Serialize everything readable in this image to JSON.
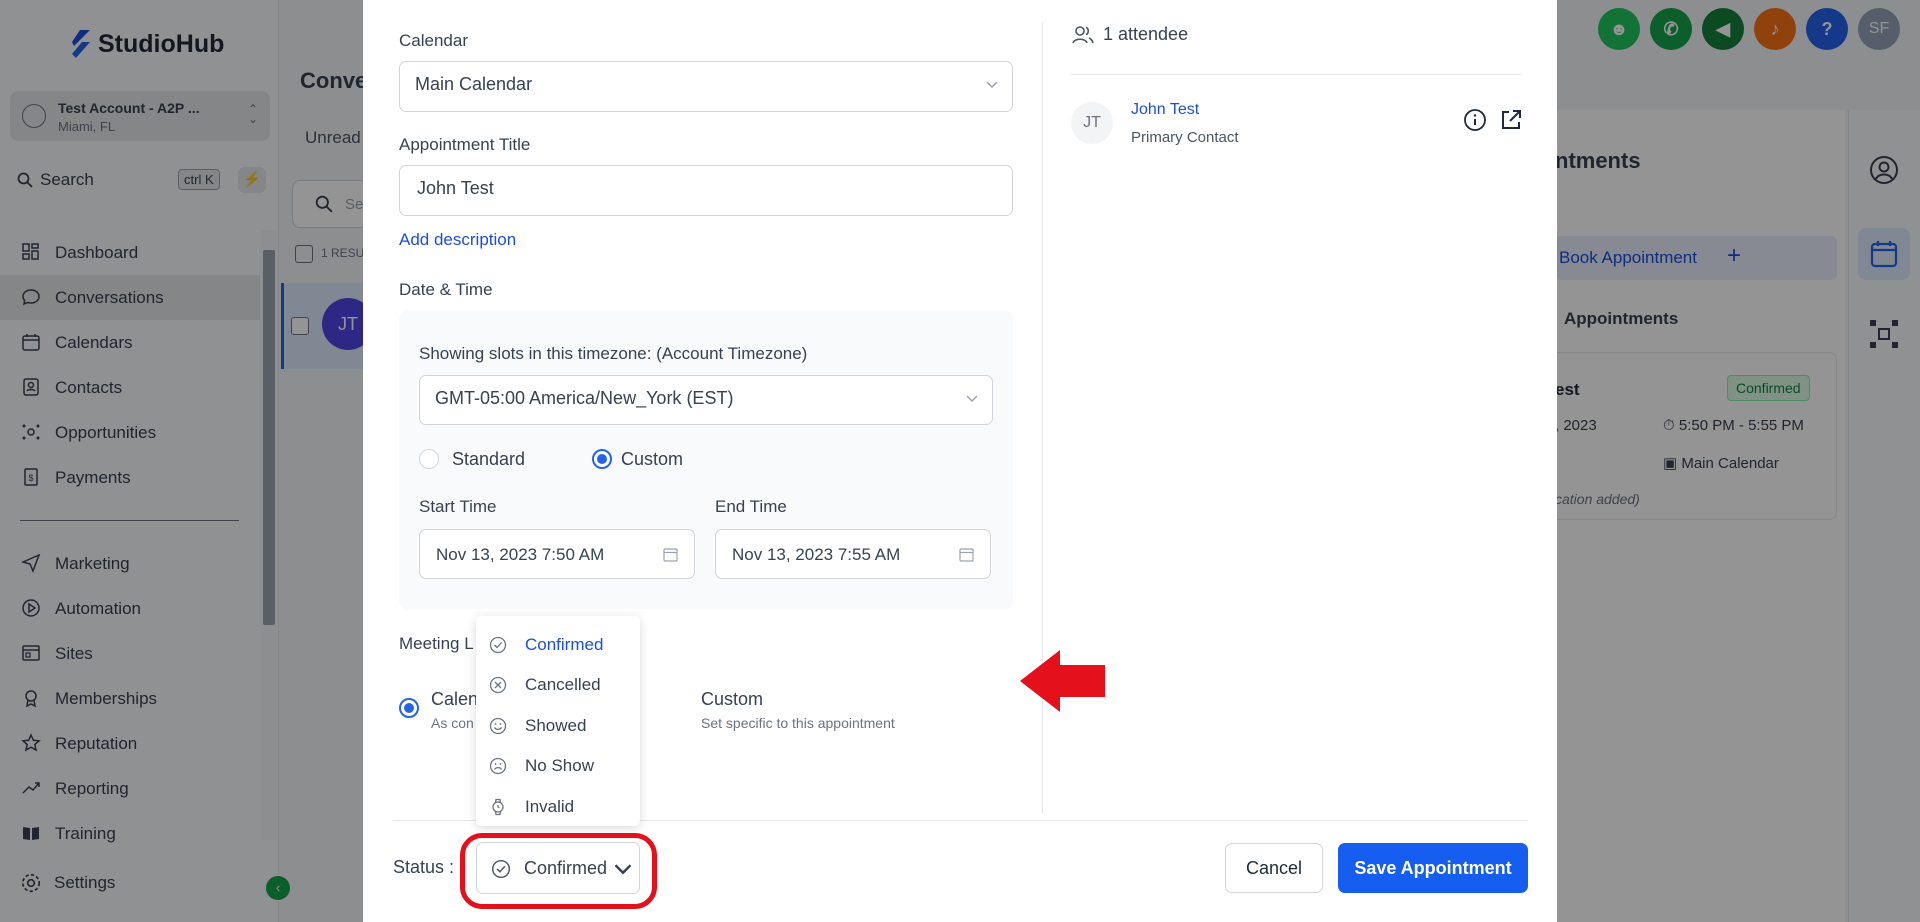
{
  "app": {
    "brand": "StudioHub"
  },
  "account": {
    "name": "Test Account - A2P ...",
    "location": "Miami, FL"
  },
  "search": {
    "label": "Search",
    "shortcut": "ctrl K"
  },
  "nav": {
    "items": [
      {
        "label": "Dashboard",
        "icon": "grid-icon"
      },
      {
        "label": "Conversations",
        "icon": "chat-icon"
      },
      {
        "label": "Calendars",
        "icon": "calendar-icon"
      },
      {
        "label": "Contacts",
        "icon": "contacts-icon"
      },
      {
        "label": "Opportunities",
        "icon": "opportunities-icon"
      },
      {
        "label": "Payments",
        "icon": "payments-icon"
      }
    ],
    "items2": [
      {
        "label": "Marketing",
        "icon": "send-icon"
      },
      {
        "label": "Automation",
        "icon": "automation-icon"
      },
      {
        "label": "Sites",
        "icon": "sites-icon"
      },
      {
        "label": "Memberships",
        "icon": "memberships-icon"
      },
      {
        "label": "Reputation",
        "icon": "star-icon"
      },
      {
        "label": "Reporting",
        "icon": "chart-icon"
      },
      {
        "label": "Training",
        "icon": "book-icon"
      }
    ],
    "settings": "Settings"
  },
  "background": {
    "title": "Conve",
    "tab_unread": "Unread",
    "search_placeholder": "Se",
    "results": "1 RESU",
    "row_avatar": "JT",
    "panel_title": "ntments",
    "book_button": "Book Appointment",
    "appointments_heading": "Appointments",
    "card": {
      "title": "est",
      "badge": "Confirmed",
      "date": ", 2023",
      "time": "5:50 PM - 5:55 PM",
      "calendar": "Main Calendar",
      "location": "cation added)"
    },
    "top_icons": [
      {
        "icon": "robot-icon",
        "color": "#22c55e",
        "glyph": "☻"
      },
      {
        "icon": "phone-icon",
        "color": "#16a34a",
        "glyph": "✆"
      },
      {
        "icon": "megaphone-icon",
        "color": "#15803d",
        "glyph": "◀"
      },
      {
        "icon": "bell-icon",
        "color": "#f97316",
        "glyph": "♪"
      },
      {
        "icon": "help-icon",
        "color": "#2563eb",
        "glyph": "?"
      },
      {
        "icon": "user-avatar",
        "color": "#94a3b8",
        "glyph": "SF"
      }
    ]
  },
  "modal": {
    "calendar_label": "Calendar",
    "calendar_value": "Main Calendar",
    "title_label": "Appointment Title",
    "title_value": "John Test",
    "add_description": "Add description",
    "datetime_label": "Date & Time",
    "timezone_label": "Showing slots in this timezone: (Account Timezone)",
    "timezone_value": "GMT-05:00 America/New_York (EST)",
    "radio_standard": "Standard",
    "radio_custom": "Custom",
    "start_label": "Start Time",
    "start_value": "Nov 13, 2023 7:50 AM",
    "end_label": "End Time",
    "end_value": "Nov 13, 2023 7:55 AM",
    "meeting_label": "Meeting L",
    "meeting_option1": "Calen",
    "meeting_option1_sub": "As con",
    "meeting_option2": "Custom",
    "meeting_option2_sub": "Set specific to this appointment",
    "attendees": "1 attendee",
    "attendee": {
      "initials": "JT",
      "name": "John Test",
      "role": "Primary Contact"
    },
    "status_label": "Status :",
    "status_value": "Confirmed",
    "status_options": [
      {
        "label": "Confirmed",
        "icon": "check-circle-icon"
      },
      {
        "label": "Cancelled",
        "icon": "x-circle-icon"
      },
      {
        "label": "Showed",
        "icon": "smile-icon"
      },
      {
        "label": "No Show",
        "icon": "frown-icon"
      },
      {
        "label": "Invalid",
        "icon": "watch-icon"
      }
    ],
    "cancel": "Cancel",
    "save": "Save Appointment"
  }
}
